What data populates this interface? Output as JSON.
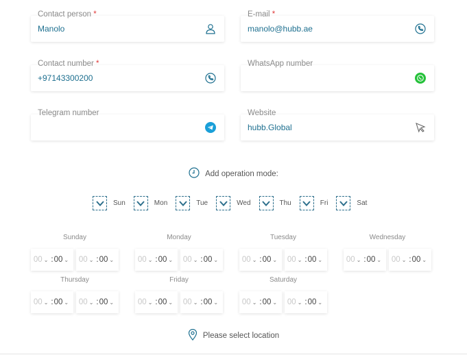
{
  "fields": {
    "contact_person": {
      "label": "Contact person",
      "required": "*",
      "value": "Manolo"
    },
    "email": {
      "label": "E-mail",
      "required": "*",
      "value": "manolo@hubb.ae"
    },
    "contact_number": {
      "label": "Contact number",
      "required": "*",
      "value": "+97143300200"
    },
    "whatsapp": {
      "label": "WhatsApp number",
      "value": ""
    },
    "telegram": {
      "label": "Telegram number",
      "value": ""
    },
    "website": {
      "label": "Website",
      "value": "hubb.Global"
    }
  },
  "operation_mode": {
    "label": "Add operation mode:"
  },
  "days": [
    "Sun",
    "Mon",
    "Tue",
    "Wed",
    "Thu",
    "Fri",
    "Sat"
  ],
  "schedule": [
    {
      "day": "Sunday",
      "open": {
        "h": "00",
        "m": "00"
      },
      "close": {
        "h": "00",
        "m": "00"
      }
    },
    {
      "day": "Monday",
      "open": {
        "h": "00",
        "m": "00"
      },
      "close": {
        "h": "00",
        "m": "00"
      }
    },
    {
      "day": "Tuesday",
      "open": {
        "h": "00",
        "m": "00"
      },
      "close": {
        "h": "00",
        "m": "00"
      }
    },
    {
      "day": "Wednesday",
      "open": {
        "h": "00",
        "m": "00"
      },
      "close": {
        "h": "00",
        "m": "00"
      }
    },
    {
      "day": "Thursday",
      "open": {
        "h": "00",
        "m": "00"
      },
      "close": {
        "h": "00",
        "m": "00"
      }
    },
    {
      "day": "Friday",
      "open": {
        "h": "00",
        "m": "00"
      },
      "close": {
        "h": "00",
        "m": "00"
      }
    },
    {
      "day": "Saturday",
      "open": {
        "h": "00",
        "m": "00"
      },
      "close": {
        "h": "00",
        "m": "00"
      }
    }
  ],
  "location": {
    "label": "Please select location"
  },
  "colors": {
    "accent": "#1d6f8f",
    "required": "#e03a3a",
    "whatsapp": "#25c13a",
    "telegram": "#1a9fd8"
  }
}
